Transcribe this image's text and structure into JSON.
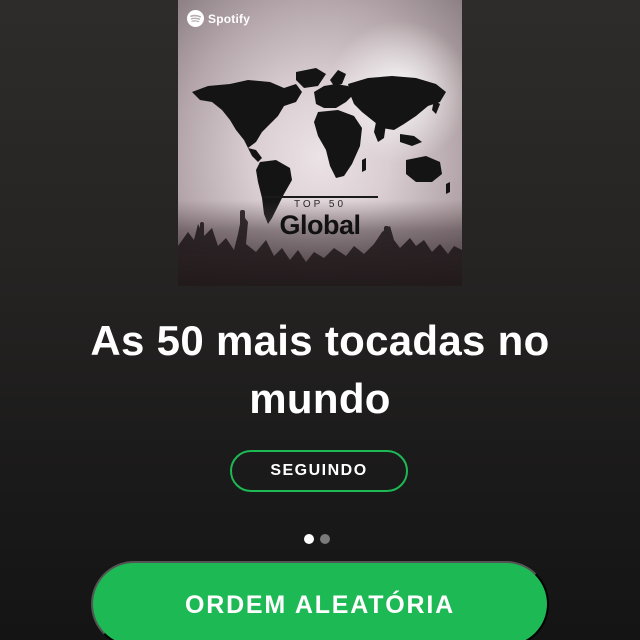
{
  "cover": {
    "brand": "Spotify",
    "kicker": "TOP 50",
    "heading": "Global"
  },
  "playlist": {
    "title": "As 50 mais tocadas no mundo"
  },
  "actions": {
    "follow_label": "SEGUINDO",
    "shuffle_label": "ORDEM ALEATÓRIA"
  },
  "pager": {
    "total": 2,
    "current": 1
  },
  "colors": {
    "accent": "#1db954",
    "background": "#232121",
    "text": "#ffffff",
    "dot_inactive": "#7a7a7a"
  },
  "icons": {
    "brand": "spotify-logo-icon",
    "cover_art": "world-map-icon"
  }
}
